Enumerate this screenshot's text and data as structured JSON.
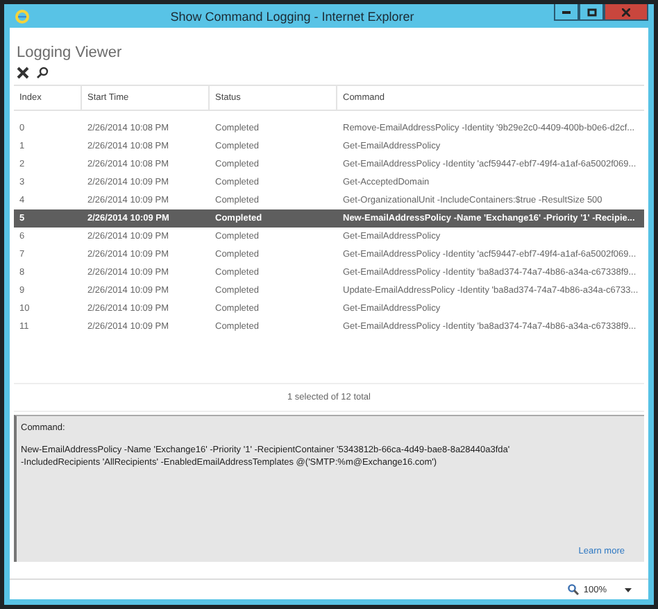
{
  "window": {
    "title": "Show Command Logging - Internet Explorer"
  },
  "page_title": "Logging Viewer",
  "table": {
    "columns": [
      "Index",
      "Start Time",
      "Status",
      "Command"
    ],
    "rows": [
      {
        "index": "0",
        "start_time": "2/26/2014 10:08 PM",
        "status": "Completed",
        "command": "Remove-EmailAddressPolicy -Identity '9b29e2c0-4409-400b-b0e6-d2cf...",
        "selected": false
      },
      {
        "index": "1",
        "start_time": "2/26/2014 10:08 PM",
        "status": "Completed",
        "command": "Get-EmailAddressPolicy",
        "selected": false
      },
      {
        "index": "2",
        "start_time": "2/26/2014 10:08 PM",
        "status": "Completed",
        "command": "Get-EmailAddressPolicy -Identity 'acf59447-ebf7-49f4-a1af-6a5002f069...",
        "selected": false
      },
      {
        "index": "3",
        "start_time": "2/26/2014 10:09 PM",
        "status": "Completed",
        "command": "Get-AcceptedDomain",
        "selected": false
      },
      {
        "index": "4",
        "start_time": "2/26/2014 10:09 PM",
        "status": "Completed",
        "command": "Get-OrganizationalUnit -IncludeContainers:$true -ResultSize 500",
        "selected": false
      },
      {
        "index": "5",
        "start_time": "2/26/2014 10:09 PM",
        "status": "Completed",
        "command": "New-EmailAddressPolicy -Name 'Exchange16' -Priority '1' -Recipie...",
        "selected": true
      },
      {
        "index": "6",
        "start_time": "2/26/2014 10:09 PM",
        "status": "Completed",
        "command": "Get-EmailAddressPolicy",
        "selected": false
      },
      {
        "index": "7",
        "start_time": "2/26/2014 10:09 PM",
        "status": "Completed",
        "command": "Get-EmailAddressPolicy -Identity 'acf59447-ebf7-49f4-a1af-6a5002f069...",
        "selected": false
      },
      {
        "index": "8",
        "start_time": "2/26/2014 10:09 PM",
        "status": "Completed",
        "command": "Get-EmailAddressPolicy -Identity 'ba8ad374-74a7-4b86-a34a-c67338f9...",
        "selected": false
      },
      {
        "index": "9",
        "start_time": "2/26/2014 10:09 PM",
        "status": "Completed",
        "command": "Update-EmailAddressPolicy -Identity 'ba8ad374-74a7-4b86-a34a-c6733...",
        "selected": false
      },
      {
        "index": "10",
        "start_time": "2/26/2014 10:09 PM",
        "status": "Completed",
        "command": "Get-EmailAddressPolicy",
        "selected": false
      },
      {
        "index": "11",
        "start_time": "2/26/2014 10:09 PM",
        "status": "Completed",
        "command": "Get-EmailAddressPolicy -Identity 'ba8ad374-74a7-4b86-a34a-c67338f9...",
        "selected": false
      }
    ]
  },
  "selection_summary": "1 selected of 12 total",
  "details": {
    "label": "Command:",
    "lines": [
      "New-EmailAddressPolicy -Name 'Exchange16' -Priority '1' -RecipientContainer '5343812b-66ca-4d49-bae8-8a28440a3fda'",
      "-IncludedRecipients 'AllRecipients' -EnabledEmailAddressTemplates @('SMTP:%m@Exchange16.com')"
    ],
    "link": "Learn more"
  },
  "status_bar": {
    "zoom": "100%"
  }
}
